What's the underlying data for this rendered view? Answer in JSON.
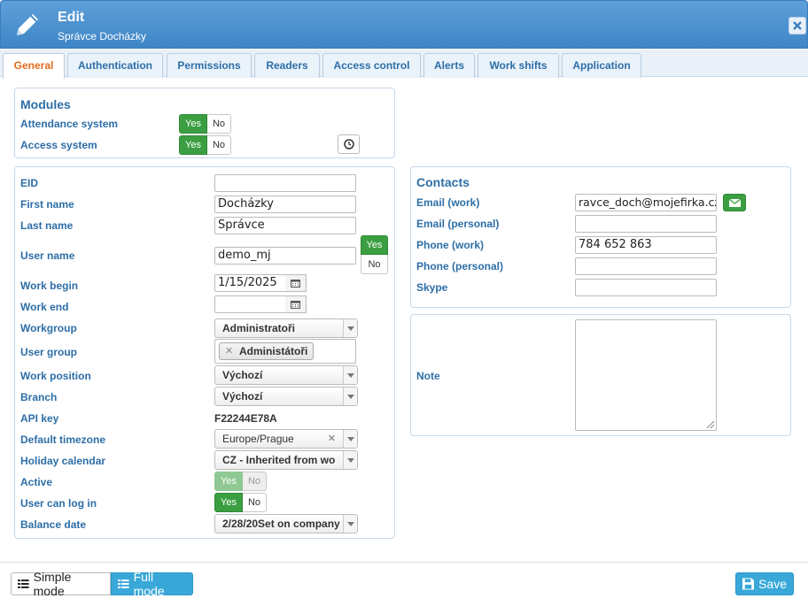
{
  "header": {
    "title": "Edit",
    "subtitle": "Správce Docházky",
    "close_icon": "close-icon",
    "edit_icon": "pencil-icon"
  },
  "tabs": [
    {
      "label": "General",
      "active": true
    },
    {
      "label": "Authentication"
    },
    {
      "label": "Permissions"
    },
    {
      "label": "Readers"
    },
    {
      "label": "Access control"
    },
    {
      "label": "Alerts"
    },
    {
      "label": "Work shifts"
    },
    {
      "label": "Application"
    }
  ],
  "modules": {
    "title": "Modules",
    "attendance_label": "Attendance system",
    "access_label": "Access system",
    "yes": "Yes",
    "no": "No"
  },
  "user": {
    "eid_label": "EID",
    "eid_value": "",
    "first_name_label": "First name",
    "first_name_value": "Docházky",
    "last_name_label": "Last name",
    "last_name_value": "Správce",
    "user_name_label": "User name",
    "user_name_value": "demo_mj",
    "work_begin_label": "Work begin",
    "work_begin_value": "1/15/2025",
    "work_end_label": "Work end",
    "work_end_value": "",
    "workgroup_label": "Workgroup",
    "workgroup_value": "Administratoři",
    "user_group_label": "User group",
    "user_group_tag": "Administátoři",
    "work_position_label": "Work position",
    "work_position_value": "Výchozí",
    "branch_label": "Branch",
    "branch_value": "Výchozí",
    "api_key_label": "API key",
    "api_key_value": "F22244E78A",
    "timezone_label": "Default timezone",
    "timezone_value": "Europe/Prague",
    "holiday_label": "Holiday calendar",
    "holiday_value": "CZ - Inherited from wo",
    "active_label": "Active",
    "login_label": "User can log in",
    "balance_label": "Balance date",
    "balance_value": "2/28/20Set on company"
  },
  "contacts": {
    "title": "Contacts",
    "email_work_label": "Email (work)",
    "email_work_value": "ravce_doch@mojefirka.cz",
    "email_personal_label": "Email (personal)",
    "email_personal_value": "",
    "phone_work_label": "Phone (work)",
    "phone_work_value": "784 652 863",
    "phone_personal_label": "Phone (personal)",
    "phone_personal_value": "",
    "skype_label": "Skype",
    "skype_value": ""
  },
  "note": {
    "label": "Note",
    "value": ""
  },
  "footer": {
    "simple_mode": "Simple mode",
    "full_mode": "Full mode",
    "save": "Save"
  },
  "colors": {
    "accent": "#2d6ea7",
    "active_tab": "#e06c1a",
    "yes_green": "#3b9f42",
    "mode_active": "#39a8d9"
  }
}
